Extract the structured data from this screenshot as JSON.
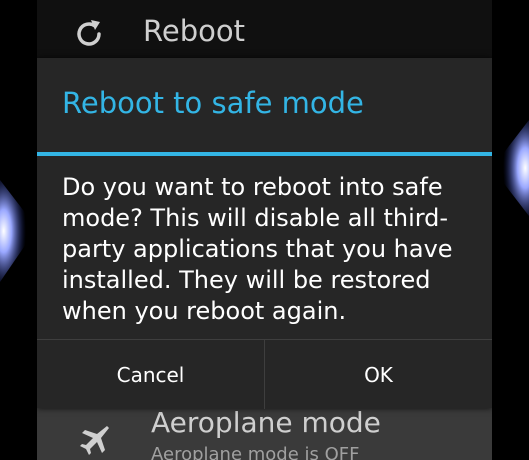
{
  "power_menu": {
    "reboot_label": "Reboot",
    "airplane_label": "Aeroplane mode",
    "airplane_status": "Aeroplane mode is OFF"
  },
  "dialog": {
    "title": "Reboot to safe mode",
    "message_lines": [
      "Do you want to reboot into safe",
      "mode? This will disable all third-",
      "party applications that you have",
      "installed. They will be restored",
      "when you reboot again."
    ],
    "cancel_label": "Cancel",
    "ok_label": "OK"
  },
  "colors": {
    "accent": "#33b5e5",
    "dialog_bg": "#262626",
    "text": "#ffffff",
    "wallpaper_glow": "#9aa8ff"
  },
  "icons": {
    "reboot": "refresh-icon",
    "airplane": "airplane-icon"
  }
}
